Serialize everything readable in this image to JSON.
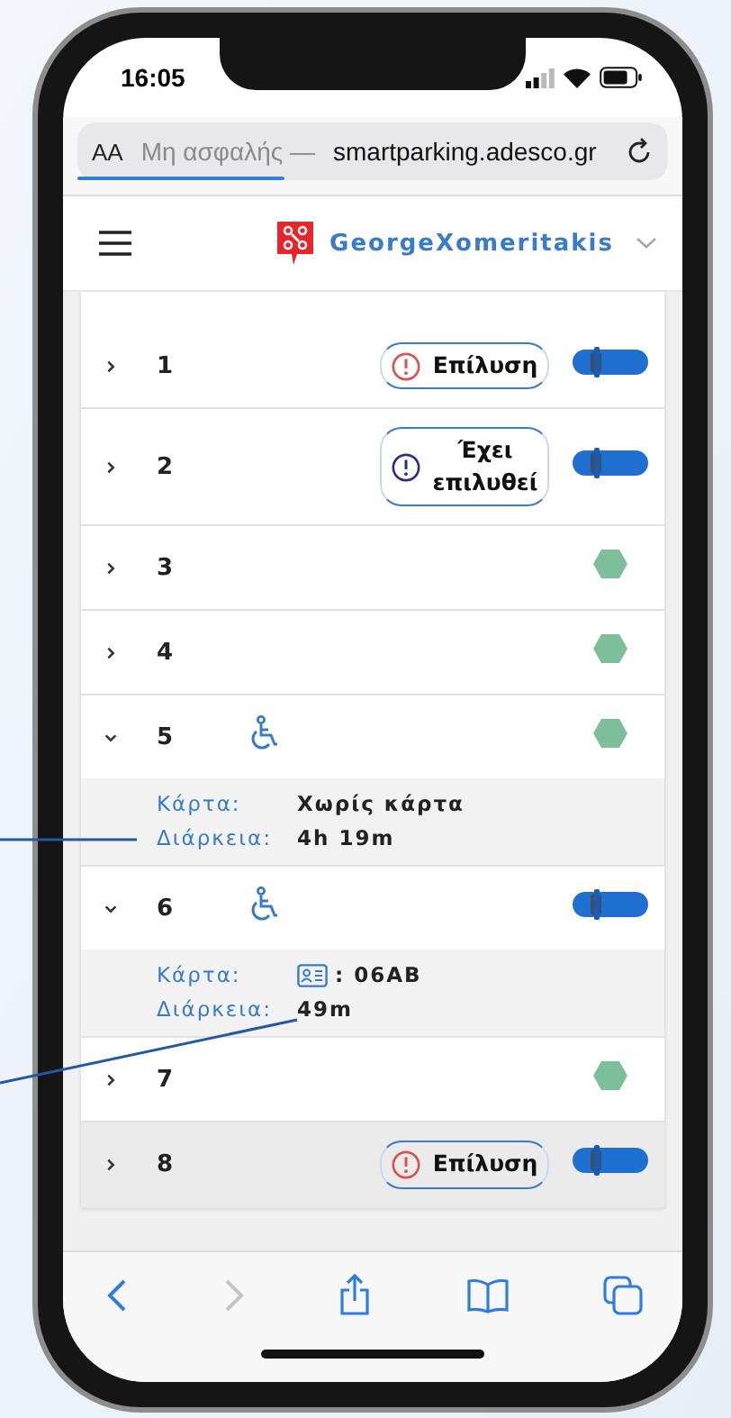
{
  "status_bar": {
    "time": "16:05"
  },
  "browser": {
    "text_size_button": "AA",
    "security": "Μη ασφαλής —",
    "address": "smartparking.adesco.gr",
    "level": 0.35
  },
  "header": {
    "user": "GeorgeXomeritakis"
  },
  "spots": [
    {
      "number": "1",
      "expanded": false,
      "highlighted": false,
      "accessible": false,
      "alert": {
        "kind": "unresolved",
        "label": "Επίλυση"
      },
      "occupied": true
    },
    {
      "number": "2",
      "expanded": false,
      "highlighted": false,
      "accessible": false,
      "alert": {
        "kind": "resolved",
        "label": "Έχει επιλυθεί"
      },
      "occupied": true
    },
    {
      "number": "3",
      "expanded": false,
      "highlighted": false,
      "accessible": false,
      "occupied": false
    },
    {
      "number": "4",
      "expanded": false,
      "highlighted": false,
      "accessible": false,
      "occupied": false
    },
    {
      "number": "5",
      "expanded": true,
      "highlighted": false,
      "accessible": true,
      "occupied": false,
      "details": {
        "card_label": "Κάρτα:",
        "card_icon": false,
        "card_value": "Χωρίς κάρτα",
        "duration_label": "Διάρκεια:",
        "duration_value": "4h 19m"
      }
    },
    {
      "number": "6",
      "expanded": true,
      "highlighted": false,
      "accessible": true,
      "occupied": true,
      "details": {
        "card_label": "Κάρτα:",
        "card_icon": true,
        "card_value": ": 06AB",
        "duration_label": "Διάρκεια:",
        "duration_value": "49m"
      }
    },
    {
      "number": "7",
      "expanded": false,
      "highlighted": false,
      "accessible": false,
      "occupied": false
    },
    {
      "number": "8",
      "expanded": false,
      "highlighted": true,
      "accessible": false,
      "alert": {
        "kind": "unresolved",
        "label": "Επίλυση"
      },
      "occupied": true
    }
  ]
}
